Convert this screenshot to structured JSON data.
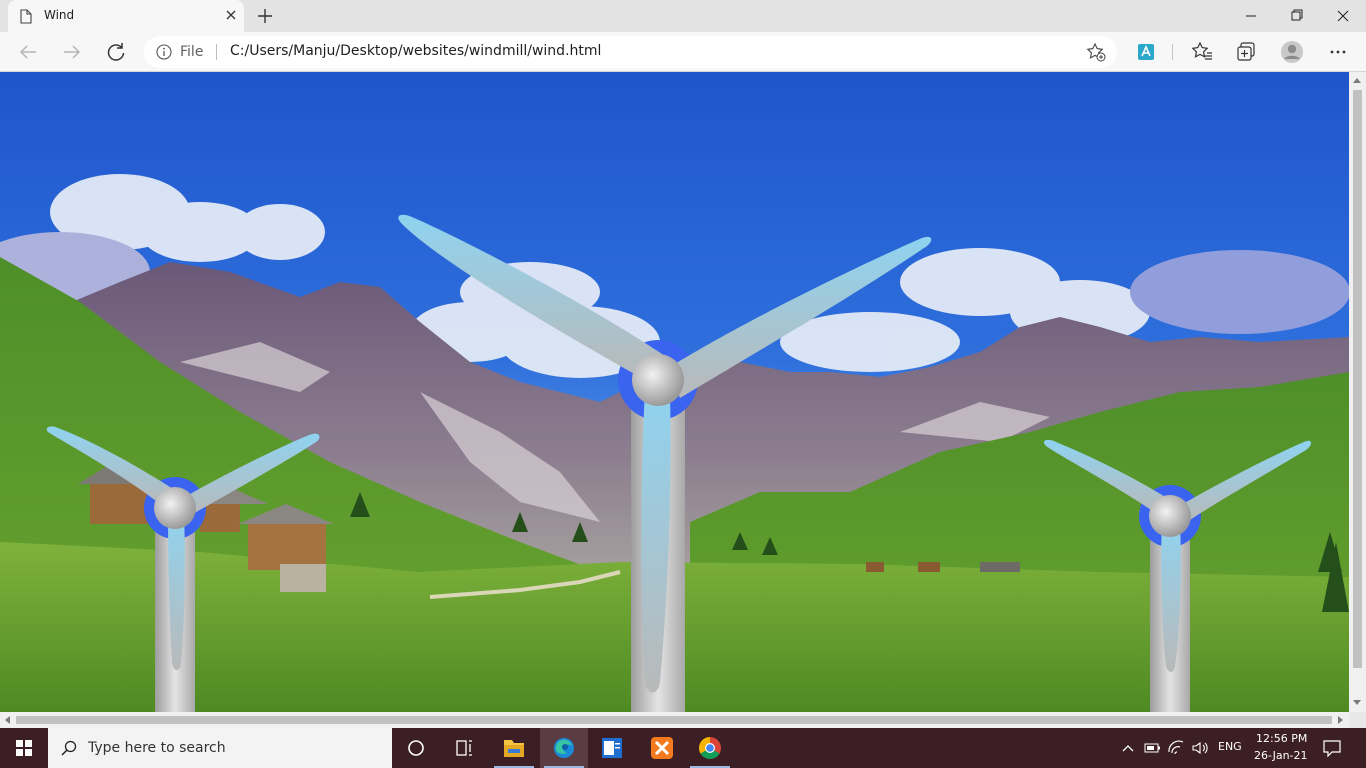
{
  "browser": {
    "tab_title": "Wind",
    "address_scheme_label": "File",
    "url": "C:/Users/Manju/Desktop/websites/windmill/wind.html"
  },
  "page": {
    "sky_color": "#2a63d8",
    "grass_color": "#5a9a2a",
    "turbine_tower_color": "#c9c9c9",
    "turbine_blade_color": "#8fd0ee",
    "turbine_hub_ring_color": "#3a63f0"
  },
  "taskbar": {
    "search_placeholder": "Type here to search",
    "language": "ENG",
    "time": "12:56 PM",
    "date": "26-Jan-21",
    "apps": [
      "task-view-icon",
      "file-explorer-icon",
      "edge-icon",
      "outlook-icon",
      "xampp-icon",
      "chrome-icon"
    ]
  }
}
